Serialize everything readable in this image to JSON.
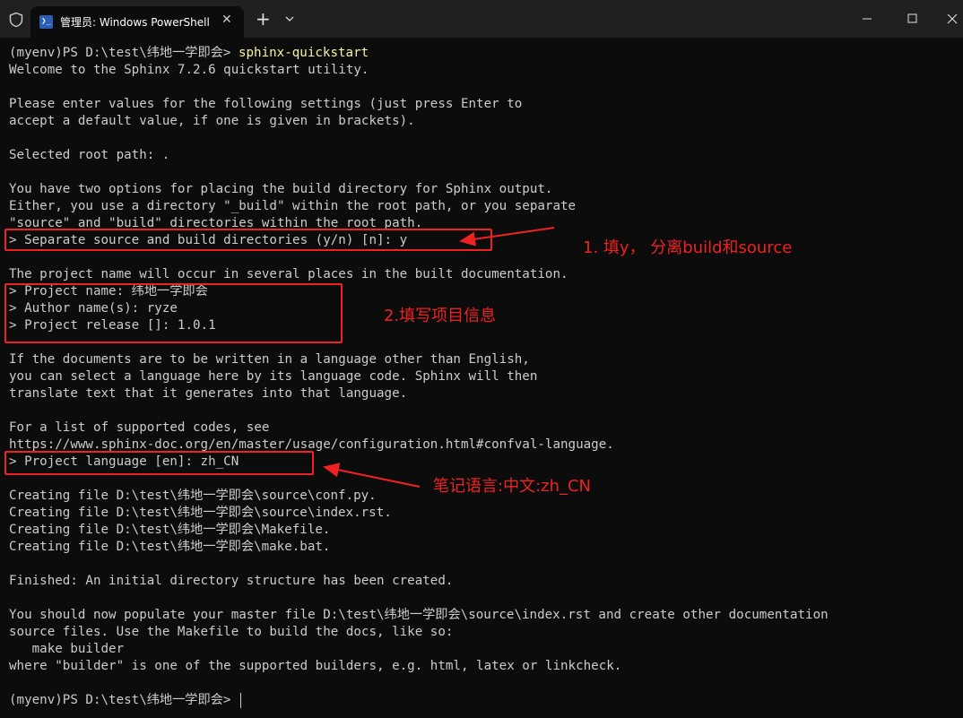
{
  "window": {
    "tab_title": "管理员: Windows PowerShell",
    "tab_icon_glyph": "❯_",
    "close_tab_glyph": "✕",
    "new_tab_glyph": "+"
  },
  "terminal": {
    "lines": [
      {
        "prefix": "(myenv)PS D:\\test\\纬地一学即会> ",
        "cmd": "sphinx-quickstart"
      },
      {
        "text": "Welcome to the Sphinx 7.2.6 quickstart utility."
      },
      {
        "text": ""
      },
      {
        "text": "Please enter values for the following settings (just press Enter to"
      },
      {
        "text": "accept a default value, if one is given in brackets)."
      },
      {
        "text": ""
      },
      {
        "text": "Selected root path: ."
      },
      {
        "text": ""
      },
      {
        "text": "You have two options for placing the build directory for Sphinx output."
      },
      {
        "text": "Either, you use a directory \"_build\" within the root path, or you separate"
      },
      {
        "text": "\"source\" and \"build\" directories within the root path."
      },
      {
        "text": "> Separate source and build directories (y/n) [n]: y"
      },
      {
        "text": ""
      },
      {
        "text": "The project name will occur in several places in the built documentation."
      },
      {
        "text": "> Project name: 纬地一学即会"
      },
      {
        "text": "> Author name(s): ryze"
      },
      {
        "text": "> Project release []: 1.0.1"
      },
      {
        "text": ""
      },
      {
        "text": "If the documents are to be written in a language other than English,"
      },
      {
        "text": "you can select a language here by its language code. Sphinx will then"
      },
      {
        "text": "translate text that it generates into that language."
      },
      {
        "text": ""
      },
      {
        "text": "For a list of supported codes, see"
      },
      {
        "text": "https://www.sphinx-doc.org/en/master/usage/configuration.html#confval-language."
      },
      {
        "text": "> Project language [en]: zh_CN"
      },
      {
        "text": ""
      },
      {
        "text": "Creating file D:\\test\\纬地一学即会\\source\\conf.py."
      },
      {
        "text": "Creating file D:\\test\\纬地一学即会\\source\\index.rst."
      },
      {
        "text": "Creating file D:\\test\\纬地一学即会\\Makefile."
      },
      {
        "text": "Creating file D:\\test\\纬地一学即会\\make.bat."
      },
      {
        "text": ""
      },
      {
        "text": "Finished: An initial directory structure has been created."
      },
      {
        "text": ""
      },
      {
        "text": "You should now populate your master file D:\\test\\纬地一学即会\\source\\index.rst and create other documentation"
      },
      {
        "text": "source files. Use the Makefile to build the docs, like so:"
      },
      {
        "text": "   make builder"
      },
      {
        "text": "where \"builder\" is one of the supported builders, e.g. html, latex or linkcheck."
      },
      {
        "text": ""
      },
      {
        "prefix": "(myenv)PS D:\\test\\纬地一学即会> ",
        "cmd": ""
      }
    ]
  },
  "annotations": {
    "note1": "1. 填y， 分离build和source",
    "note2": "2.填写项目信息",
    "note3": "笔记语言:中文:zh_CN"
  },
  "colors": {
    "background": "#0c0c0c",
    "text": "#cccccc",
    "command": "#f9f1a5",
    "annotation": "#ee2222"
  }
}
